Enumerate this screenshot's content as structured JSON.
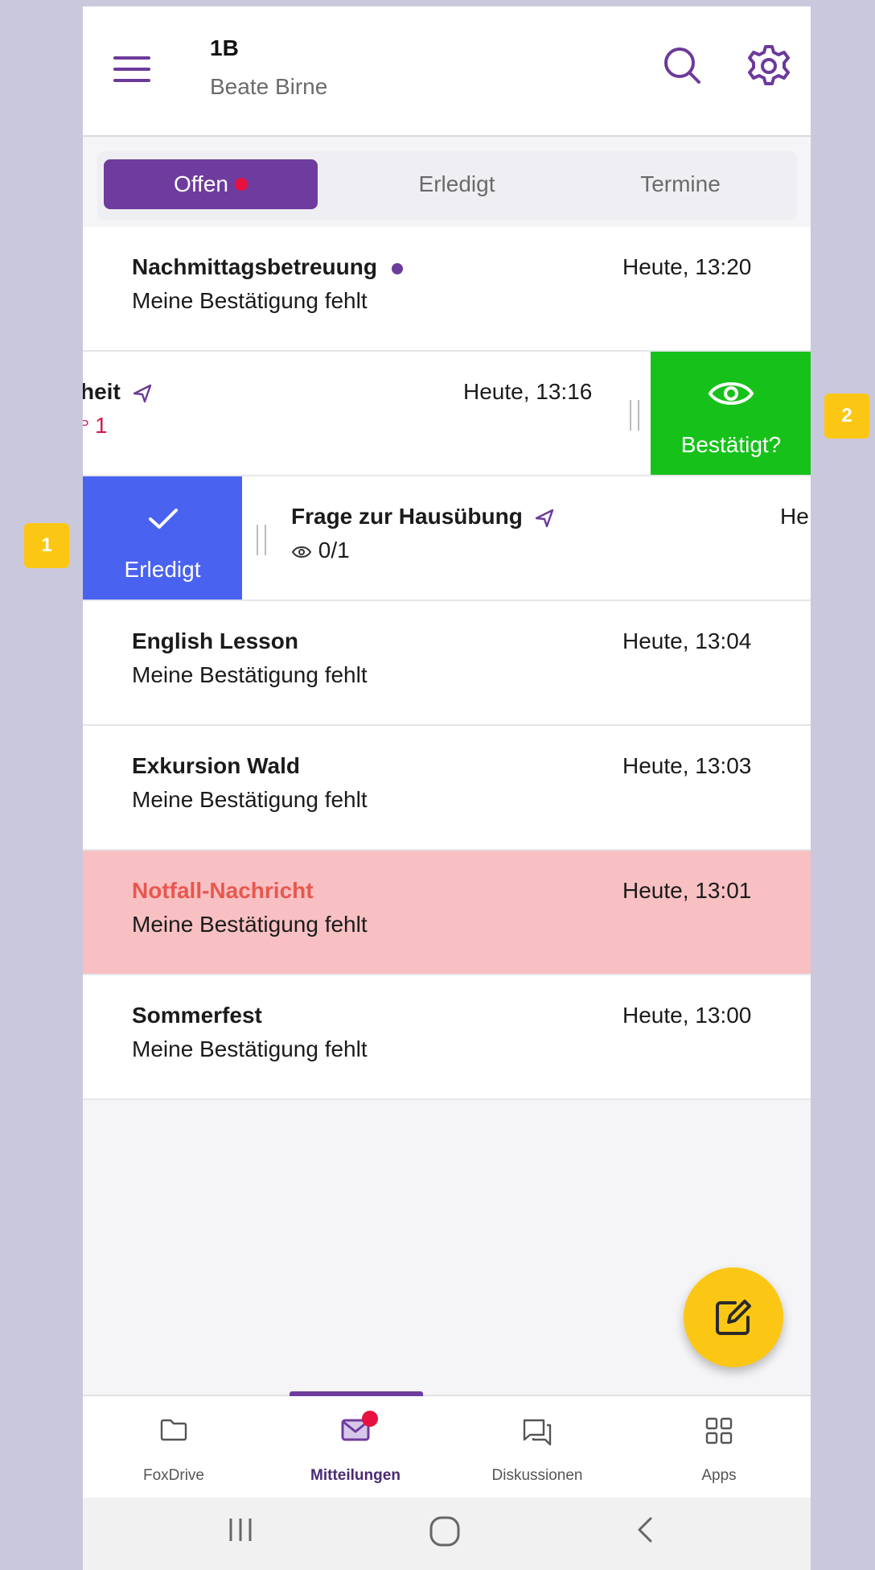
{
  "header": {
    "title": "1B",
    "subtitle": "Beate Birne"
  },
  "tabs": [
    {
      "label": "Offen",
      "active": true,
      "has_dot": true
    },
    {
      "label": "Erledigt",
      "active": false
    },
    {
      "label": "Termine",
      "active": false
    }
  ],
  "messages": [
    {
      "title": "Nachmittagsbetreuung",
      "subtitle": "Meine Bestätigung fehlt",
      "time": "Heute, 13:20",
      "unread": true
    },
    {
      "title": "heit",
      "subtitle": "1",
      "time": "Heute, 13:16",
      "swipe_action": "Bestätigt?"
    },
    {
      "title": "Frage zur Hausübung",
      "subtitle": "0/1",
      "time": "He",
      "swipe_action": "Erledigt"
    },
    {
      "title": "English Lesson",
      "subtitle": "Meine Bestätigung fehlt",
      "time": "Heute, 13:04"
    },
    {
      "title": "Exkursion Wald",
      "subtitle": "Meine Bestätigung fehlt",
      "time": "Heute, 13:03"
    },
    {
      "title": "Notfall-Nachricht",
      "subtitle": "Meine Bestätigung fehlt",
      "time": "Heute, 13:01",
      "emergency": true
    },
    {
      "title": "Sommerfest",
      "subtitle": "Meine Bestätigung fehlt",
      "time": "Heute, 13:00"
    }
  ],
  "bottom_nav": [
    {
      "label": "FoxDrive",
      "icon": "folder-icon"
    },
    {
      "label": "Mitteilungen",
      "icon": "mail-icon",
      "active": true,
      "badge": true
    },
    {
      "label": "Diskussionen",
      "icon": "chat-icon"
    },
    {
      "label": "Apps",
      "icon": "apps-grid-icon"
    }
  ],
  "callouts": [
    "1",
    "2"
  ],
  "colors": {
    "brand_purple": "#6e3c9e",
    "confirm_green": "#16c21a",
    "done_blue": "#4a62f0",
    "emergency_bg": "#f8c0c2",
    "emergency_text": "#e8574f",
    "fab_yellow": "#fcc714",
    "alert_red": "#e8103e"
  }
}
